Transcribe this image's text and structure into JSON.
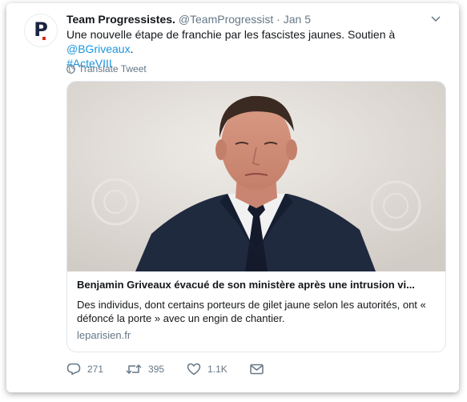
{
  "tweet": {
    "author_name": "Team Progressistes.",
    "handle": "@TeamProgressist",
    "separator": "·",
    "date": "Jan 5",
    "avatar_letter": "P",
    "text_main": "Une nouvelle étape de franchie par les fascistes jaunes. Soutien à ",
    "mention": "@BGriveaux",
    "text_period": ".",
    "hashtag": "#ActeVIII",
    "translate_label": "Translate Tweet"
  },
  "preview": {
    "title": "Benjamin Griveaux évacué de son ministère après une intrusion vi...",
    "description": "Des individus, dont certains porteurs de gilet jaune selon les autorités, ont « défoncé la porte » avec un engin de chantier.",
    "domain": "leparisien.fr"
  },
  "actions": {
    "replies": "271",
    "retweets": "395",
    "likes": "1.1K"
  },
  "colors": {
    "link": "#1b95e0",
    "muted": "#657786",
    "text": "#14171a",
    "brand_red": "#e2231a"
  }
}
